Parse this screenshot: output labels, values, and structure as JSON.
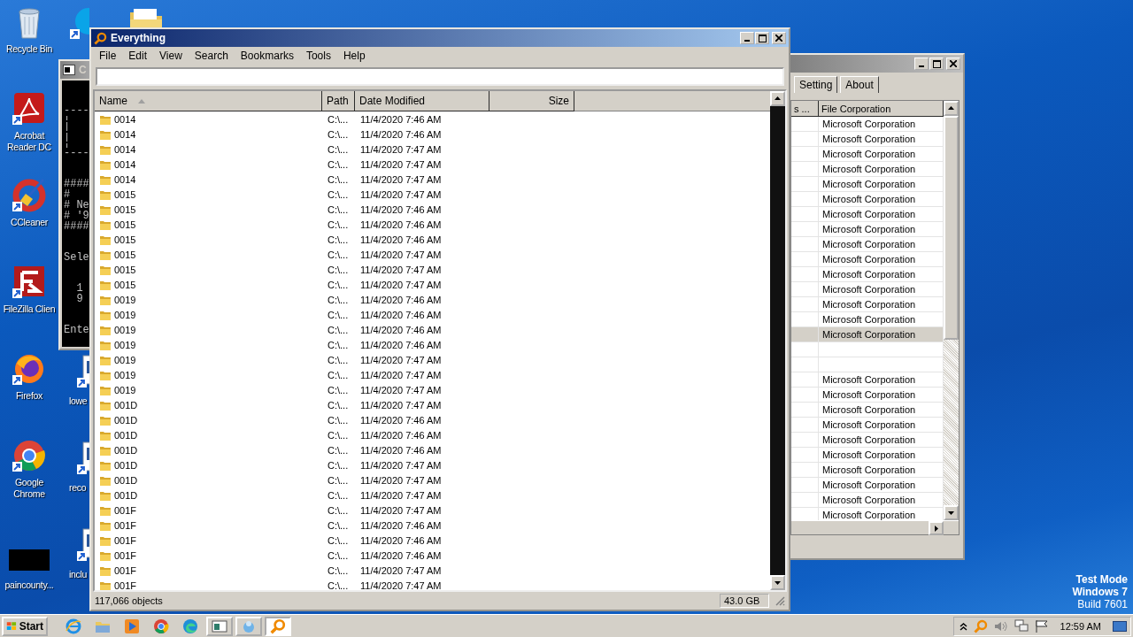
{
  "desktop_icons": [
    {
      "label": "Recycle Bin",
      "kind": "recycle_bin",
      "shortcut": false
    },
    {
      "label": "Acrobat\nReader DC",
      "kind": "acrobat",
      "shortcut": true
    },
    {
      "label": "CCleaner",
      "kind": "ccleaner",
      "shortcut": true
    },
    {
      "label": "FileZilla Clien",
      "kind": "filezilla",
      "shortcut": true
    },
    {
      "label": "Firefox",
      "kind": "firefox",
      "shortcut": true
    },
    {
      "label": "Google\nChrome",
      "kind": "chrome",
      "shortcut": true
    },
    {
      "label": "paincounty...",
      "kind": "thumbnail",
      "shortcut": false
    }
  ],
  "desktop_icons_column_2": [
    {
      "label": "lowe",
      "kind": "document",
      "shortcut": true
    },
    {
      "label": "reco",
      "kind": "document",
      "shortcut": true
    },
    {
      "label": "inclu",
      "kind": "document",
      "shortcut": true
    }
  ],
  "desktop_icons_top": [
    {
      "kind": "skype",
      "shortcut": true
    },
    {
      "kind": "folder"
    }
  ],
  "console_window": {
    "title": "C",
    "blocks": [
      [
        "----",
        "¦",
        "¦",
        "¦",
        "----"
      ],
      [
        "####",
        "#",
        "# Ne",
        "# '9",
        "####"
      ],
      [
        "Sele"
      ],
      [
        "  1",
        "  9"
      ],
      [
        "Ente"
      ]
    ]
  },
  "process_window": {
    "tabs": [
      {
        "label": "Setting",
        "selected": false
      },
      {
        "label": "About",
        "selected": false
      }
    ],
    "columns": [
      "s ...",
      "File Corporation"
    ],
    "rows": [
      {
        "file_corporation": "Microsoft Corporation",
        "selected": false
      },
      {
        "file_corporation": "Microsoft Corporation",
        "selected": false
      },
      {
        "file_corporation": "Microsoft Corporation",
        "selected": false
      },
      {
        "file_corporation": "Microsoft Corporation",
        "selected": false
      },
      {
        "file_corporation": "Microsoft Corporation",
        "selected": false
      },
      {
        "file_corporation": "Microsoft Corporation",
        "selected": false
      },
      {
        "file_corporation": "Microsoft Corporation",
        "selected": false
      },
      {
        "file_corporation": "Microsoft Corporation",
        "selected": false
      },
      {
        "file_corporation": "Microsoft Corporation",
        "selected": false
      },
      {
        "file_corporation": "Microsoft Corporation",
        "selected": false
      },
      {
        "file_corporation": "Microsoft Corporation",
        "selected": false
      },
      {
        "file_corporation": "Microsoft Corporation",
        "selected": false
      },
      {
        "file_corporation": "Microsoft Corporation",
        "selected": false
      },
      {
        "file_corporation": "Microsoft Corporation",
        "selected": false
      },
      {
        "file_corporation": "Microsoft Corporation",
        "selected": true
      },
      {
        "selected": false
      },
      {
        "selected": false
      },
      {
        "file_corporation": "Microsoft Corporation",
        "selected": false
      },
      {
        "file_corporation": "Microsoft Corporation",
        "selected": false
      },
      {
        "file_corporation": "Microsoft Corporation",
        "selected": false
      },
      {
        "file_corporation": "Microsoft Corporation",
        "selected": false
      },
      {
        "file_corporation": "Microsoft Corporation",
        "selected": false
      },
      {
        "file_corporation": "Microsoft Corporation",
        "selected": false
      },
      {
        "file_corporation": "Microsoft Corporation",
        "selected": false
      },
      {
        "file_corporation": "Microsoft Corporation",
        "selected": false
      },
      {
        "file_corporation": "Microsoft Corporation",
        "selected": false
      },
      {
        "file_corporation": "Microsoft Corporation",
        "selected": false
      }
    ]
  },
  "everything_window": {
    "title": "Everything",
    "menu": [
      "File",
      "Edit",
      "View",
      "Search",
      "Bookmarks",
      "Tools",
      "Help"
    ],
    "columns": [
      "Name",
      "Path",
      "Date Modified",
      "Size"
    ],
    "rows": [
      {
        "name": "0014",
        "path": "C:\\...",
        "date_modified": "11/4/2020 7:46 AM"
      },
      {
        "name": "0014",
        "path": "C:\\...",
        "date_modified": "11/4/2020 7:46 AM"
      },
      {
        "name": "0014",
        "path": "C:\\...",
        "date_modified": "11/4/2020 7:47 AM"
      },
      {
        "name": "0014",
        "path": "C:\\...",
        "date_modified": "11/4/2020 7:47 AM"
      },
      {
        "name": "0014",
        "path": "C:\\...",
        "date_modified": "11/4/2020 7:47 AM"
      },
      {
        "name": "0015",
        "path": "C:\\...",
        "date_modified": "11/4/2020 7:47 AM"
      },
      {
        "name": "0015",
        "path": "C:\\...",
        "date_modified": "11/4/2020 7:46 AM"
      },
      {
        "name": "0015",
        "path": "C:\\...",
        "date_modified": "11/4/2020 7:46 AM"
      },
      {
        "name": "0015",
        "path": "C:\\...",
        "date_modified": "11/4/2020 7:46 AM"
      },
      {
        "name": "0015",
        "path": "C:\\...",
        "date_modified": "11/4/2020 7:47 AM"
      },
      {
        "name": "0015",
        "path": "C:\\...",
        "date_modified": "11/4/2020 7:47 AM"
      },
      {
        "name": "0015",
        "path": "C:\\...",
        "date_modified": "11/4/2020 7:47 AM"
      },
      {
        "name": "0019",
        "path": "C:\\...",
        "date_modified": "11/4/2020 7:46 AM"
      },
      {
        "name": "0019",
        "path": "C:\\...",
        "date_modified": "11/4/2020 7:46 AM"
      },
      {
        "name": "0019",
        "path": "C:\\...",
        "date_modified": "11/4/2020 7:46 AM"
      },
      {
        "name": "0019",
        "path": "C:\\...",
        "date_modified": "11/4/2020 7:46 AM"
      },
      {
        "name": "0019",
        "path": "C:\\...",
        "date_modified": "11/4/2020 7:47 AM"
      },
      {
        "name": "0019",
        "path": "C:\\...",
        "date_modified": "11/4/2020 7:47 AM"
      },
      {
        "name": "0019",
        "path": "C:\\...",
        "date_modified": "11/4/2020 7:47 AM"
      },
      {
        "name": "001D",
        "path": "C:\\...",
        "date_modified": "11/4/2020 7:47 AM"
      },
      {
        "name": "001D",
        "path": "C:\\...",
        "date_modified": "11/4/2020 7:46 AM"
      },
      {
        "name": "001D",
        "path": "C:\\...",
        "date_modified": "11/4/2020 7:46 AM"
      },
      {
        "name": "001D",
        "path": "C:\\...",
        "date_modified": "11/4/2020 7:46 AM"
      },
      {
        "name": "001D",
        "path": "C:\\...",
        "date_modified": "11/4/2020 7:47 AM"
      },
      {
        "name": "001D",
        "path": "C:\\...",
        "date_modified": "11/4/2020 7:47 AM"
      },
      {
        "name": "001D",
        "path": "C:\\...",
        "date_modified": "11/4/2020 7:47 AM"
      },
      {
        "name": "001F",
        "path": "C:\\...",
        "date_modified": "11/4/2020 7:47 AM"
      },
      {
        "name": "001F",
        "path": "C:\\...",
        "date_modified": "11/4/2020 7:46 AM"
      },
      {
        "name": "001F",
        "path": "C:\\...",
        "date_modified": "11/4/2020 7:46 AM"
      },
      {
        "name": "001F",
        "path": "C:\\...",
        "date_modified": "11/4/2020 7:46 AM"
      },
      {
        "name": "001F",
        "path": "C:\\...",
        "date_modified": "11/4/2020 7:47 AM"
      },
      {
        "name": "001F",
        "path": "C:\\...",
        "date_modified": "11/4/2020 7:47 AM"
      }
    ],
    "status_bar": {
      "objects": "117,066 objects",
      "size": "43.0 GB"
    }
  },
  "taskbar": {
    "start": "Start",
    "items": [
      {
        "kind": "ie",
        "selected": false
      },
      {
        "kind": "explorer",
        "selected": false
      },
      {
        "kind": "media",
        "selected": false
      },
      {
        "kind": "chrome",
        "selected": false
      },
      {
        "kind": "edge",
        "selected": false
      },
      {
        "kind": "window",
        "selected": false
      },
      {
        "kind": "app",
        "selected": false
      },
      {
        "kind": "everything",
        "selected": true
      }
    ],
    "tray": [
      {
        "kind": "chevron"
      },
      {
        "kind": "everything"
      },
      {
        "kind": "speaker"
      },
      {
        "kind": "network"
      },
      {
        "kind": "flag"
      }
    ],
    "clock": "12:59 AM"
  },
  "watermark_lines": [
    {
      "text": "Test Mode",
      "bold": true
    },
    {
      "text": "Windows 7",
      "bold": true
    },
    {
      "text": "Build 7601",
      "bold": false
    }
  ]
}
